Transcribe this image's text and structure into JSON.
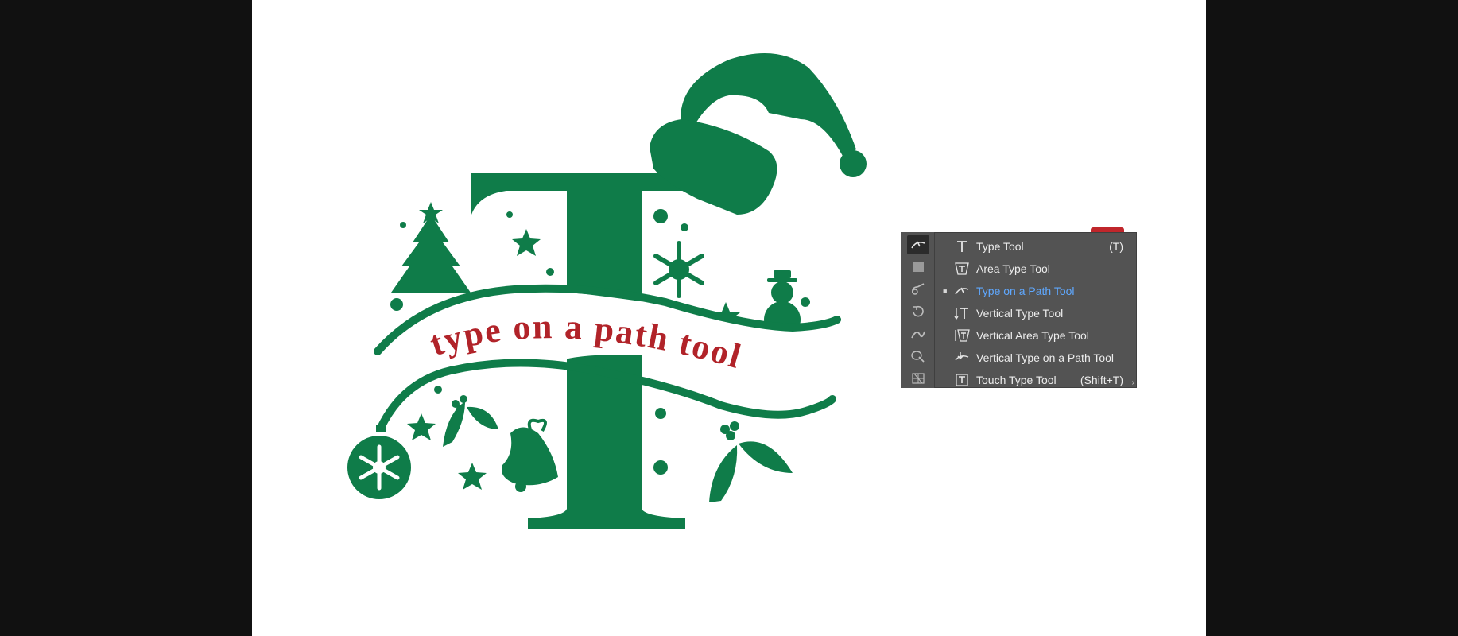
{
  "colors": {
    "background": "#111111",
    "artboard": "#ffffff",
    "art_green": "#0f7c49",
    "ribbon_text_red": "#b12329",
    "panel_bg": "#535353",
    "selected_blue": "#5fa8ff"
  },
  "artwork": {
    "letter": "T",
    "ribbon_text": "type on a path tool"
  },
  "toolbar": {
    "tools": [
      {
        "name": "type-on-path-tool-icon",
        "active": true
      },
      {
        "name": "rectangle-tool-icon",
        "active": false
      },
      {
        "name": "paintbrush-tool-icon",
        "active": false
      },
      {
        "name": "rotate-tool-icon",
        "active": false
      },
      {
        "name": "width-tool-icon",
        "active": false
      },
      {
        "name": "shape-builder-tool-icon",
        "active": false
      },
      {
        "name": "perspective-grid-tool-icon",
        "active": false
      }
    ]
  },
  "flyout": {
    "items": [
      {
        "label": "Type Tool",
        "shortcut": "(T)",
        "icon": "type-tool-icon",
        "selected": false
      },
      {
        "label": "Area Type Tool",
        "shortcut": "",
        "icon": "area-type-tool-icon",
        "selected": false
      },
      {
        "label": "Type on a Path Tool",
        "shortcut": "",
        "icon": "type-on-path-tool-icon",
        "selected": true
      },
      {
        "label": "Vertical Type Tool",
        "shortcut": "",
        "icon": "vertical-type-tool-icon",
        "selected": false
      },
      {
        "label": "Vertical Area Type Tool",
        "shortcut": "",
        "icon": "vertical-area-type-tool-icon",
        "selected": false
      },
      {
        "label": "Vertical Type on a Path Tool",
        "shortcut": "",
        "icon": "vertical-type-on-path-tool-icon",
        "selected": false
      },
      {
        "label": "Touch Type Tool",
        "shortcut": "(Shift+T)",
        "icon": "touch-type-tool-icon",
        "selected": false
      }
    ]
  }
}
